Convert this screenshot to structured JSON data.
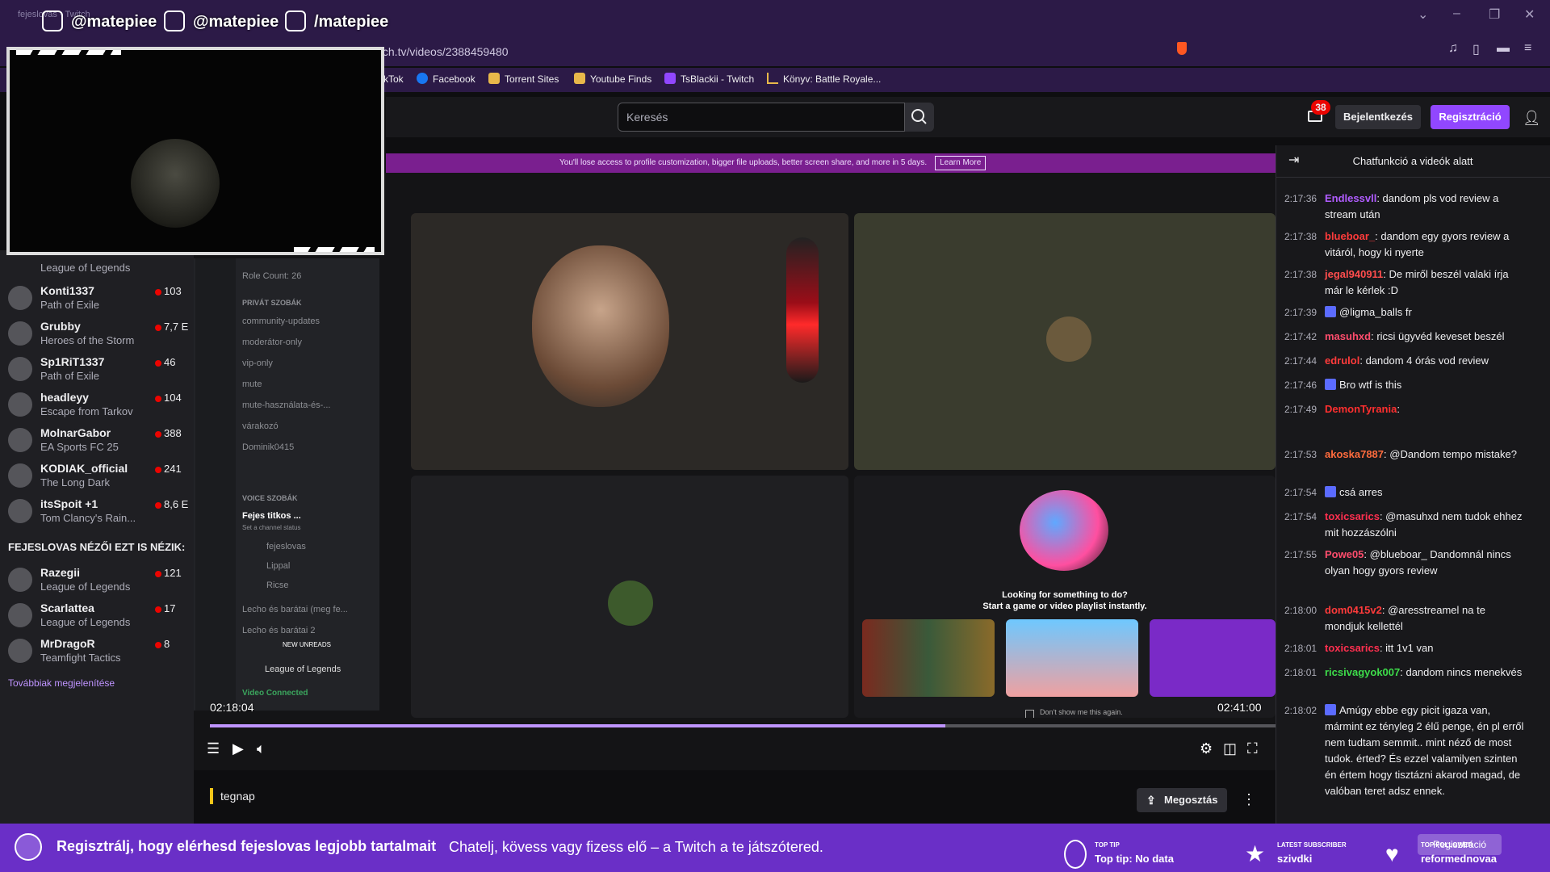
{
  "browser": {
    "tab_title": "fejeslovas - Twitch",
    "url": "tch.tv/videos/2388459480",
    "bookmarks": [
      "kTok",
      "Facebook",
      "Torrent Sites",
      "Youtube Finds",
      "TsBlackii - Twitch",
      "Könyv: Battle Royale..."
    ]
  },
  "social": {
    "instagram": "@matepiee",
    "twitter": "@matepiee",
    "youtube": "/matepiee"
  },
  "topnav": {
    "search_placeholder": "Keresés",
    "notif_count": "38",
    "login_label": "Bejelentkezés",
    "signup_label": "Regisztráció"
  },
  "promo": {
    "text": "You'll lose access to profile customization, bigger file uploads, better screen share, and more in 5 days.",
    "learn_more": "Learn More"
  },
  "sidebar": {
    "first_game": "League of Legends",
    "channels": [
      {
        "name": "Konti1337",
        "game": "Path of Exile",
        "viewers": "103"
      },
      {
        "name": "Grubby",
        "game": "Heroes of the Storm",
        "viewers": "7,7 E"
      },
      {
        "name": "Sp1RiT1337",
        "game": "Path of Exile",
        "viewers": "46"
      },
      {
        "name": "headleyy",
        "game": "Escape from Tarkov",
        "viewers": "104"
      },
      {
        "name": "MolnarGabor",
        "game": "EA Sports FC 25",
        "viewers": "388"
      },
      {
        "name": "KODIAK_official",
        "game": "The Long Dark",
        "viewers": "241"
      },
      {
        "name": "itsSpoit +1",
        "game": "Tom Clancy's Rain...",
        "viewers": "8,6 E"
      }
    ],
    "also_watch_heading": "FEJESLOVAS NÉZŐI EZT IS NÉZIK:",
    "also_watch": [
      {
        "name": "Razegii",
        "game": "League of Legends",
        "viewers": "121"
      },
      {
        "name": "Scarlattea",
        "game": "League of Legends",
        "viewers": "17"
      },
      {
        "name": "MrDragoR",
        "game": "Teamfight Tactics",
        "viewers": "8"
      }
    ],
    "show_more": "Továbbiak megjelenítése"
  },
  "discord": {
    "role_count": "Role Count: 26",
    "private_header": "PRIVÁT SZOBÁK",
    "channels": [
      "community-updates",
      "moderátor-only",
      "vip-only",
      "mute",
      "mute-használata-és-...",
      "várakozó",
      "Dominik0415"
    ],
    "voice_header": "VOICE SZOBÁK",
    "voice_channel": "Fejes titkos ...",
    "voice_sub": "Set a channel status",
    "voice_users": [
      "fejeslovas",
      "Lippal",
      "Ricse"
    ],
    "more_channels": [
      "Lecho és barátai (meg fe...",
      "Lecho és barátai 2"
    ],
    "new_unreads": "NEW UNREADS",
    "lol_room": "League of Legends",
    "video_connected": "Video Connected"
  },
  "activity": {
    "prompt_line1": "Looking for something to do?",
    "prompt_line2": "Start a game or video playlist instantly.",
    "dont_show": "Don't show me this again."
  },
  "player": {
    "time_current": "02:18:04",
    "time_total": "02:41:00",
    "progress": 0.69
  },
  "info": {
    "date": "tegnap",
    "share_label": "Megosztás"
  },
  "chat": {
    "header": "Chatfunkció a videók alatt",
    "messages": [
      {
        "time": "2:17:36",
        "user": "Endlessvll",
        "color": "#b05cff",
        "text": "dandom pls vod review a stream után"
      },
      {
        "time": "2:17:38",
        "user": "blueboar_",
        "color": "#ff3b3b",
        "text": "dandom egy gyors review a vitáról, hogy ki nyerte"
      },
      {
        "time": "2:17:38",
        "user": "jegal940911",
        "color": "#ff4d4d",
        "text": "De miről beszél valaki írja már le kérlek :D"
      },
      {
        "time": "2:17:39",
        "user": "",
        "color": "#5b6bff",
        "text": "@ligma_balls fr"
      },
      {
        "time": "2:17:42",
        "user": "masuhxd",
        "color": "#ff4d6d",
        "text": "ricsi ügyvéd keveset beszél"
      },
      {
        "time": "2:17:44",
        "user": "edrulol",
        "color": "#ff3b3b",
        "text": "dandom 4 órás vod review"
      },
      {
        "time": "2:17:46",
        "user": "",
        "color": "#5b6bff",
        "text": "Bro wtf is this"
      },
      {
        "time": "2:17:49",
        "user": "DemonTyrania",
        "color": "#ff2f2f",
        "text": ""
      },
      {
        "time": "2:17:53",
        "user": "akoska7887",
        "color": "#ff6b3d",
        "text": "@Dandom tempo mistake?"
      },
      {
        "time": "2:17:54",
        "user": "",
        "color": "#5b6bff",
        "text": "csá arres"
      },
      {
        "time": "2:17:54",
        "user": "toxicsarics",
        "color": "#ff2f4f",
        "text": "@masuhxd nem tudok ehhez mit hozzászólni"
      },
      {
        "time": "2:17:55",
        "user": "Powe05",
        "color": "#ff4d6d",
        "text": "@blueboar_ Dandomnál nincs olyan hogy gyors review"
      },
      {
        "time": "2:18:00",
        "user": "dom0415v2",
        "color": "#ff3b3b",
        "text": "@aresstreamel na te mondjuk kellettél"
      },
      {
        "time": "2:18:01",
        "user": "toxicsarics",
        "color": "#ff2f4f",
        "text": "itt 1v1 van"
      },
      {
        "time": "2:18:01",
        "user": "ricsivagyok007",
        "color": "#3ddc4a",
        "text": "dandom nincs menekvés"
      },
      {
        "time": "2:18:02",
        "user": "",
        "color": "#5b6bff",
        "text": "Amúgy ebbe egy picit igaza van, mármint ez tényleg 2 élű penge, én pl erről nem tudtam semmit.. mint néző de most tudok. érted? És ezzel valamilyen szinten én értem hogy tisztázni akarod magad, de valóban teret adsz ennek."
      }
    ]
  },
  "banner": {
    "title": "Regisztrálj, hogy elérhesd fejeslovas legjobb tartalmait",
    "subtitle": "Chatelj, kövess vagy fizess elő – a Twitch a te játszótered.",
    "top_tip_label": "TOP TIP",
    "top_tip_value": "Top tip: No data",
    "latest_sub_label": "LATEST SUBSCRIBER",
    "latest_sub_value": "szivdki",
    "top_follower_label": "TOP FOLLOWER",
    "top_follower_value": "reformednovaa",
    "signup_ghost": "Regisztráció"
  },
  "colors": {
    "twitch_purple": "#9147ff",
    "banner_purple": "#6a2fc7",
    "live_red": "#eb0400"
  }
}
